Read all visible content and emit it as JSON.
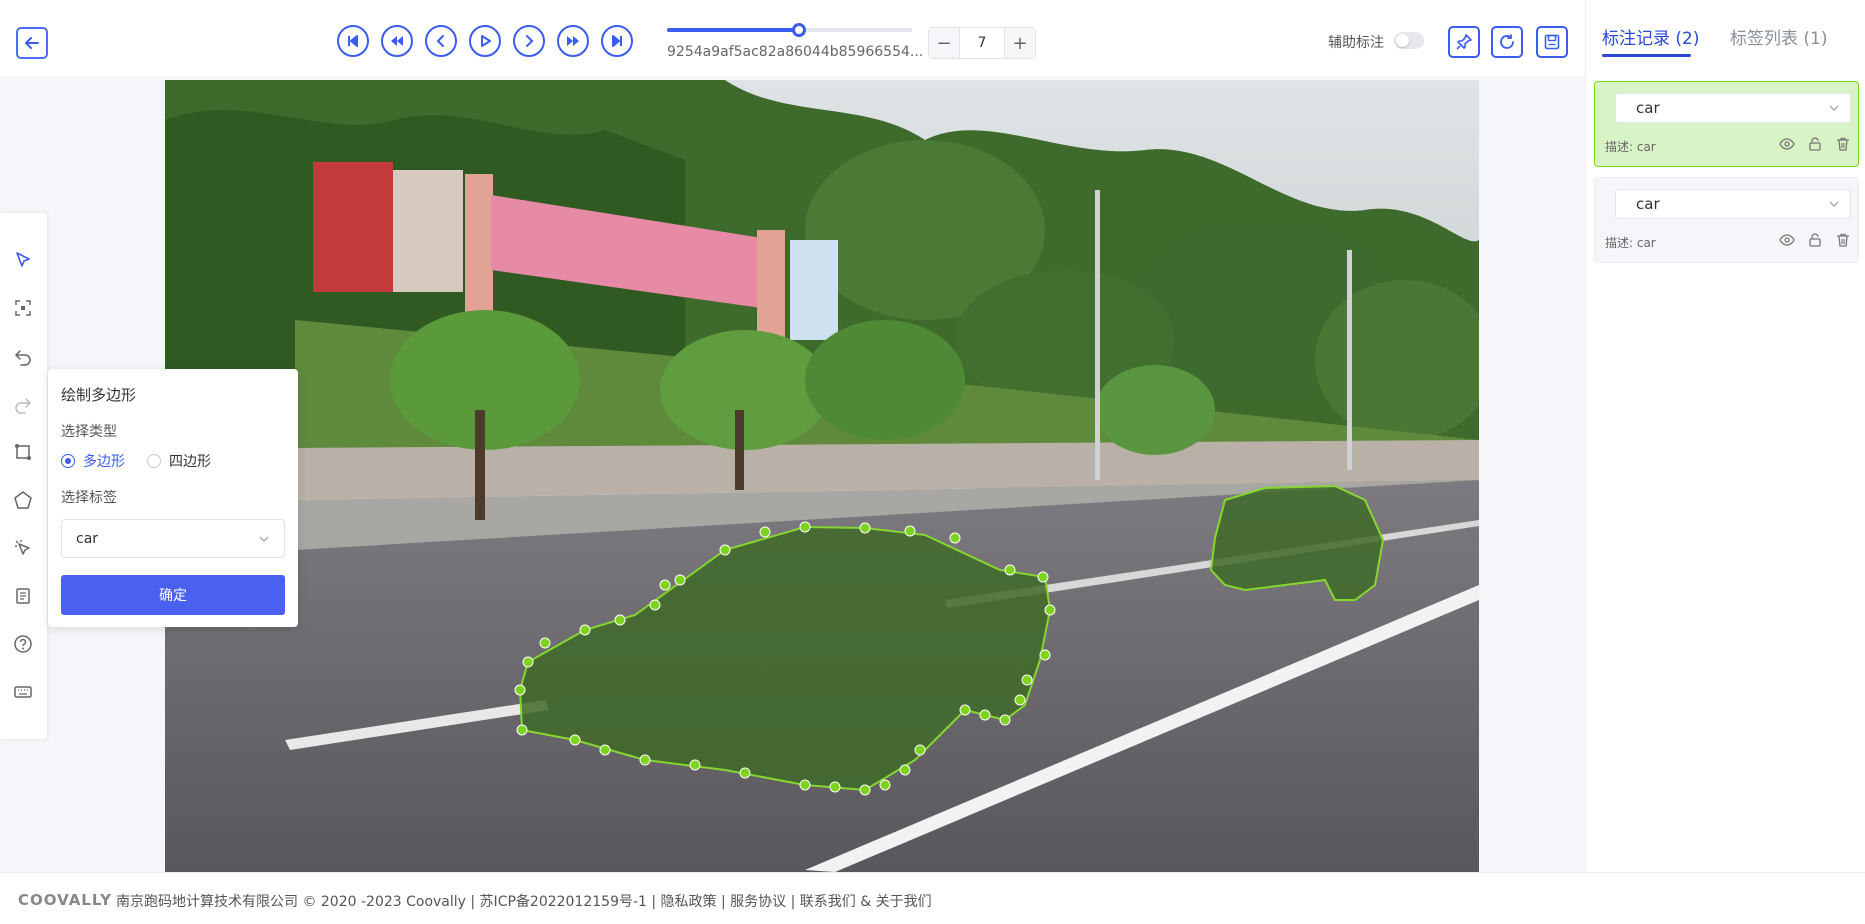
{
  "toolbar": {
    "image_id": "9254a9af5ac82a86044b85966554...",
    "page_value": "7",
    "minus_label": "−",
    "plus_label": "+",
    "aux_label": "辅助标注",
    "aux_enabled": false,
    "slider_progress": 0.54
  },
  "tools": [
    "select-icon",
    "box-select-icon",
    "undo-icon",
    "redo-icon",
    "rect-tool-icon",
    "polygon-tool-icon",
    "magic-select-icon",
    "list-icon",
    "help-icon",
    "keyboard-icon"
  ],
  "popup": {
    "title": "绘制多边形",
    "type_label": "选择类型",
    "option_polygon": "多边形",
    "option_quad": "四边形",
    "tag_label": "选择标签",
    "tag_value": "car",
    "confirm_label": "确定"
  },
  "right_panel": {
    "tab_records": "标注记录 (2)",
    "tab_labels": "标签列表 (1)",
    "records": [
      {
        "label": "car",
        "desc": "描述: car",
        "selected": true
      },
      {
        "label": "car",
        "desc": "描述: car",
        "selected": false
      }
    ]
  },
  "footer": {
    "logo": "COOVALLY",
    "text": "南京跑码地计算技术有限公司 © 2020 -2023 Coovally | 苏ICP备2022012159号-1 | 隐私政策 | 服务协议 | 联系我们 & 关于我们"
  },
  "colors": {
    "accent": "#3a5cf0",
    "annotation": "#7ed321",
    "confirm": "#4a60f0"
  }
}
